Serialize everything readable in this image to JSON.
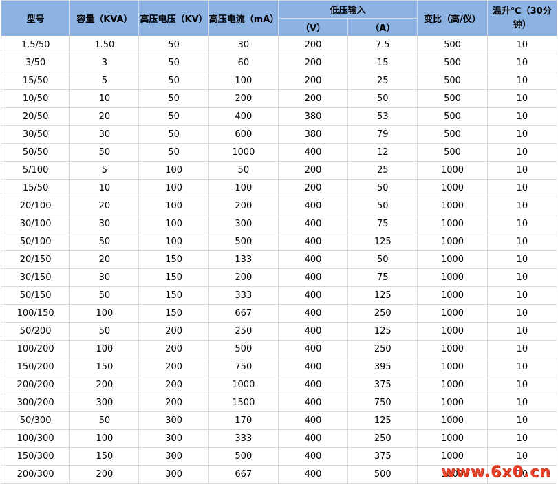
{
  "header": {
    "model": "型号",
    "capacity": "容量（KVA）",
    "hv_voltage": "高压电压（KV）",
    "hv_current": "高压电流（mA）",
    "lv_input": "低压输入",
    "lv_v": "（V）",
    "lv_a": "（A）",
    "ratio": "变比（高/仪）",
    "temp_rise": "温升℃（30分钟）"
  },
  "rows": [
    [
      "1.5/50",
      "1.50",
      "50",
      "30",
      "200",
      "7.5",
      "500",
      "10"
    ],
    [
      "3/50",
      "3",
      "50",
      "60",
      "200",
      "15",
      "500",
      "10"
    ],
    [
      "15/50",
      "5",
      "50",
      "100",
      "200",
      "25",
      "500",
      "10"
    ],
    [
      "10/50",
      "10",
      "50",
      "200",
      "200",
      "50",
      "500",
      "10"
    ],
    [
      "20/50",
      "20",
      "50",
      "400",
      "380",
      "53",
      "500",
      "10"
    ],
    [
      "30/50",
      "30",
      "50",
      "600",
      "380",
      "79",
      "500",
      "10"
    ],
    [
      "50/50",
      "50",
      "50",
      "1000",
      "400",
      "12",
      "500",
      "10"
    ],
    [
      "5/100",
      "5",
      "100",
      "50",
      "200",
      "25",
      "1000",
      "10"
    ],
    [
      "15/50",
      "10",
      "100",
      "100",
      "200",
      "50",
      "1000",
      "10"
    ],
    [
      "20/100",
      "20",
      "100",
      "200",
      "400",
      "50",
      "1000",
      "10"
    ],
    [
      "30/100",
      "30",
      "100",
      "300",
      "400",
      "75",
      "1000",
      "10"
    ],
    [
      "50/100",
      "50",
      "100",
      "500",
      "400",
      "125",
      "1000",
      "10"
    ],
    [
      "20/150",
      "20",
      "150",
      "133",
      "400",
      "50",
      "1000",
      "10"
    ],
    [
      "30/150",
      "30",
      "150",
      "200",
      "400",
      "75",
      "1000",
      "10"
    ],
    [
      "50/150",
      "50",
      "150",
      "333",
      "400",
      "125",
      "1000",
      "10"
    ],
    [
      "100/150",
      "100",
      "150",
      "667",
      "400",
      "250",
      "1000",
      "10"
    ],
    [
      "50/200",
      "50",
      "200",
      "250",
      "400",
      "125",
      "1000",
      "10"
    ],
    [
      "100/200",
      "100",
      "200",
      "500",
      "400",
      "250",
      "1000",
      "10"
    ],
    [
      "150/200",
      "150",
      "200",
      "750",
      "400",
      "395",
      "1000",
      "10"
    ],
    [
      "200/200",
      "200",
      "200",
      "1000",
      "400",
      "375",
      "1000",
      "10"
    ],
    [
      "300/200",
      "300",
      "200",
      "1500",
      "400",
      "750",
      "1000",
      "10"
    ],
    [
      "50/300",
      "50",
      "300",
      "170",
      "400",
      "125",
      "1000",
      "10"
    ],
    [
      "100/300",
      "100",
      "300",
      "333",
      "400",
      "250",
      "1000",
      "10"
    ],
    [
      "150/300",
      "150",
      "300",
      "500",
      "400",
      "375",
      "1000",
      "10"
    ],
    [
      "200/300",
      "200",
      "300",
      "667",
      "400",
      "500",
      "1000",
      "10"
    ]
  ],
  "watermark": "www.6x0.cn"
}
